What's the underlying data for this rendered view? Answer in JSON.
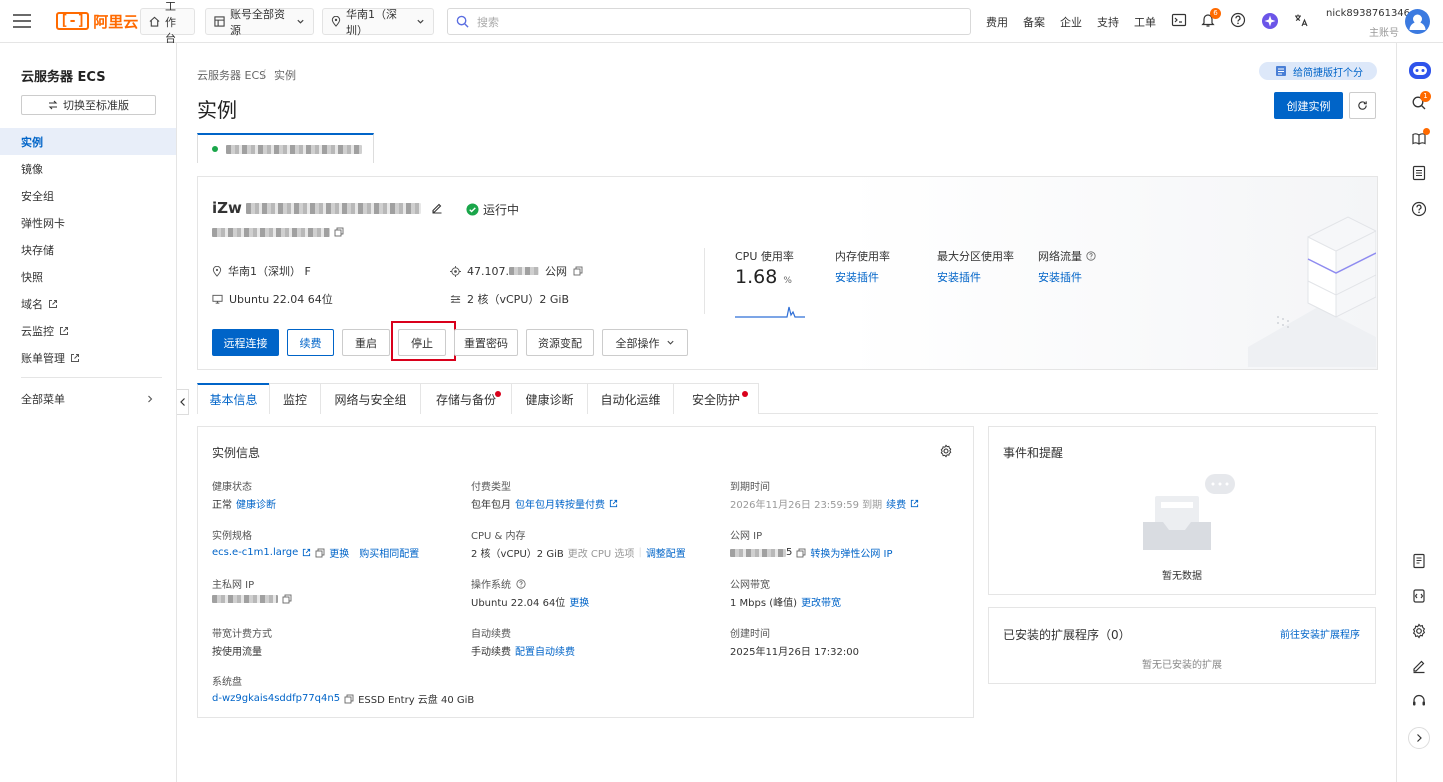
{
  "topbar": {
    "logo_text": "阿里云",
    "workbench": "工作台",
    "resources": "账号全部资源",
    "region": "华南1（深圳）",
    "search_placeholder": "搜索",
    "links": [
      "费用",
      "备案",
      "企业",
      "支持",
      "工单"
    ],
    "notification_count": "6",
    "user_name": "nick8938761346",
    "user_role": "主账号"
  },
  "sidebar": {
    "title": "云服务器 ECS",
    "switch_label": "切换至标准版",
    "items": [
      {
        "label": "实例",
        "active": true,
        "external": false
      },
      {
        "label": "镜像",
        "active": false,
        "external": false
      },
      {
        "label": "安全组",
        "active": false,
        "external": false
      },
      {
        "label": "弹性网卡",
        "active": false,
        "external": false
      },
      {
        "label": "块存储",
        "active": false,
        "external": false
      },
      {
        "label": "快照",
        "active": false,
        "external": false
      },
      {
        "label": "域名",
        "active": false,
        "external": true
      },
      {
        "label": "云监控",
        "active": false,
        "external": true
      },
      {
        "label": "账单管理",
        "active": false,
        "external": true
      }
    ],
    "all_menu": "全部菜单"
  },
  "breadcrumb": [
    "云服务器 ECS",
    "实例"
  ],
  "page_title": "实例",
  "feedback_label": "给简捷版打个分",
  "create_button": "创建实例",
  "rail": {
    "search_badge": "1"
  },
  "instance": {
    "name_prefix": "iZw",
    "status": "运行中",
    "region": "华南1（深圳）  F",
    "public_ip_prefix": "47.107.",
    "public_ip_suffix": "公网",
    "os": "Ubuntu 22.04 64位",
    "cpu_mem": "2 核（vCPU）2 GiB"
  },
  "metrics": {
    "cpu_label": "CPU 使用率",
    "cpu_value": "1.68",
    "cpu_unit": "%",
    "mem_label": "内存使用率",
    "disk_label": "最大分区使用率",
    "net_label": "网络流量",
    "install_link": "安装插件"
  },
  "actions": [
    "远程连接",
    "续费",
    "重启",
    "停止",
    "重置密码",
    "资源变配",
    "全部操作"
  ],
  "tabs": [
    {
      "label": "基本信息",
      "active": true,
      "dot": false
    },
    {
      "label": "监控",
      "active": false,
      "dot": false
    },
    {
      "label": "网络与安全组",
      "active": false,
      "dot": false
    },
    {
      "label": "存储与备份",
      "active": false,
      "dot": true
    },
    {
      "label": "健康诊断",
      "active": false,
      "dot": false
    },
    {
      "label": "自动化运维",
      "active": false,
      "dot": false
    },
    {
      "label": "安全防护",
      "active": false,
      "dot": true
    }
  ],
  "info": {
    "title": "实例信息",
    "health_label": "健康状态",
    "health_value": "正常",
    "health_link": "健康诊断",
    "pay_label": "付费类型",
    "pay_value": "包年包月",
    "pay_link": "包年包月转按量付费",
    "expire_label": "到期时间",
    "expire_value": "2026年11月26日 23:59:59  到期",
    "expire_link": "续费",
    "spec_label": "实例规格",
    "spec_value": "ecs.e-c1m1.large",
    "spec_link1": "更换",
    "spec_link2": "购买相同配置",
    "cpu_label": "CPU & 内存",
    "cpu_value": "2 核（vCPU）2 GiB",
    "cpu_muted": "更改 CPU 选项",
    "cpu_link": "调整配置",
    "pubip_label": "公网 IP",
    "pubip_suffix": "5",
    "pubip_link": "转换为弹性公网 IP",
    "privip_label": "主私网 IP",
    "os_label": "操作系统",
    "os_value": "Ubuntu 22.04 64位",
    "os_link": "更换",
    "bw_label": "公网带宽",
    "bw_value": "1 Mbps (峰值)",
    "bw_link": "更改带宽",
    "billing_label": "带宽计费方式",
    "billing_value": "按使用流量",
    "renew_label": "自动续费",
    "renew_value": "手动续费",
    "renew_link": "配置自动续费",
    "created_label": "创建时间",
    "created_value": "2025年11月26日 17:32:00",
    "disk_label": "系统盘",
    "disk_id": "d-wz9gkais4sddfp77q4n5",
    "disk_value": "ESSD Entry 云盘  40 GiB"
  },
  "events": {
    "title": "事件和提醒",
    "empty": "暂无数据"
  },
  "extensions": {
    "title": "已安装的扩展程序（0）",
    "link": "前往安装扩展程序",
    "empty": "暂无已安装的扩展"
  },
  "colors": {
    "primary": "#0064c8",
    "brand": "#ff6a00",
    "success": "#1aa64a",
    "danger": "#d9001b"
  }
}
